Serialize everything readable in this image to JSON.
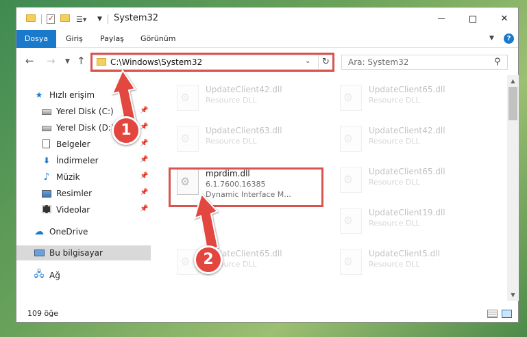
{
  "window": {
    "title": "System32"
  },
  "ribbon": {
    "tabs": [
      "Dosya",
      "Giriş",
      "Paylaş",
      "Görünüm"
    ],
    "help": "?"
  },
  "address": {
    "path": "C:\\Windows\\System32"
  },
  "search": {
    "placeholder": "Ara: System32"
  },
  "sidebar": {
    "items": [
      {
        "label": "Hızlı erişim",
        "icon": "star-icon"
      },
      {
        "label": "Yerel Disk (C:)",
        "icon": "drive-icon",
        "pinned": true
      },
      {
        "label": "Yerel Disk (D:)",
        "icon": "drive-icon",
        "pinned": true
      },
      {
        "label": "Belgeler",
        "icon": "document-icon",
        "pinned": true
      },
      {
        "label": "İndirmeler",
        "icon": "download-icon",
        "pinned": true
      },
      {
        "label": "Müzik",
        "icon": "music-icon",
        "pinned": true
      },
      {
        "label": "Resimler",
        "icon": "pictures-icon",
        "pinned": true
      },
      {
        "label": "Videolar",
        "icon": "video-icon",
        "pinned": true
      },
      {
        "label": "OneDrive",
        "icon": "cloud-icon"
      },
      {
        "label": "Bu bilgisayar",
        "icon": "computer-icon",
        "selected": true
      },
      {
        "label": "Ağ",
        "icon": "network-icon"
      }
    ]
  },
  "files": [
    {
      "name": "UpdateClient42.dll",
      "desc": "Resource DLL",
      "ghost": true
    },
    {
      "name": "UpdateClient65.dll",
      "desc": "Resource DLL",
      "ghost": true
    },
    {
      "name": "UpdateClient63.dll",
      "desc": "Resource DLL",
      "ghost": true
    },
    {
      "name": "UpdateClient42.dll",
      "desc": "Resource DLL",
      "ghost": true
    },
    {
      "name": "mprdim.dll",
      "desc": "6.1.7600.16385",
      "desc2": "Dynamic Interface M...",
      "ghost": false
    },
    {
      "name": "UpdateClient65.dll",
      "desc": "Resource DLL",
      "ghost": true
    },
    {
      "name": "UpdateClient19.dll",
      "desc": "Resource DLL",
      "ghost": true
    },
    {
      "name": "UpdateClient65.dll",
      "desc": "Resource DLL",
      "ghost": true
    },
    {
      "name": "UpdateClient5.dll",
      "desc": "Resource DLL",
      "ghost": true
    }
  ],
  "status": {
    "item_count": "109 öğe"
  },
  "annotations": {
    "step1": "1",
    "step2": "2",
    "highlight_color": "#d9534f",
    "badge_color": "#e2463f"
  },
  "colors": {
    "accent": "#1979ca",
    "selected_bg": "#d9d9d9"
  }
}
